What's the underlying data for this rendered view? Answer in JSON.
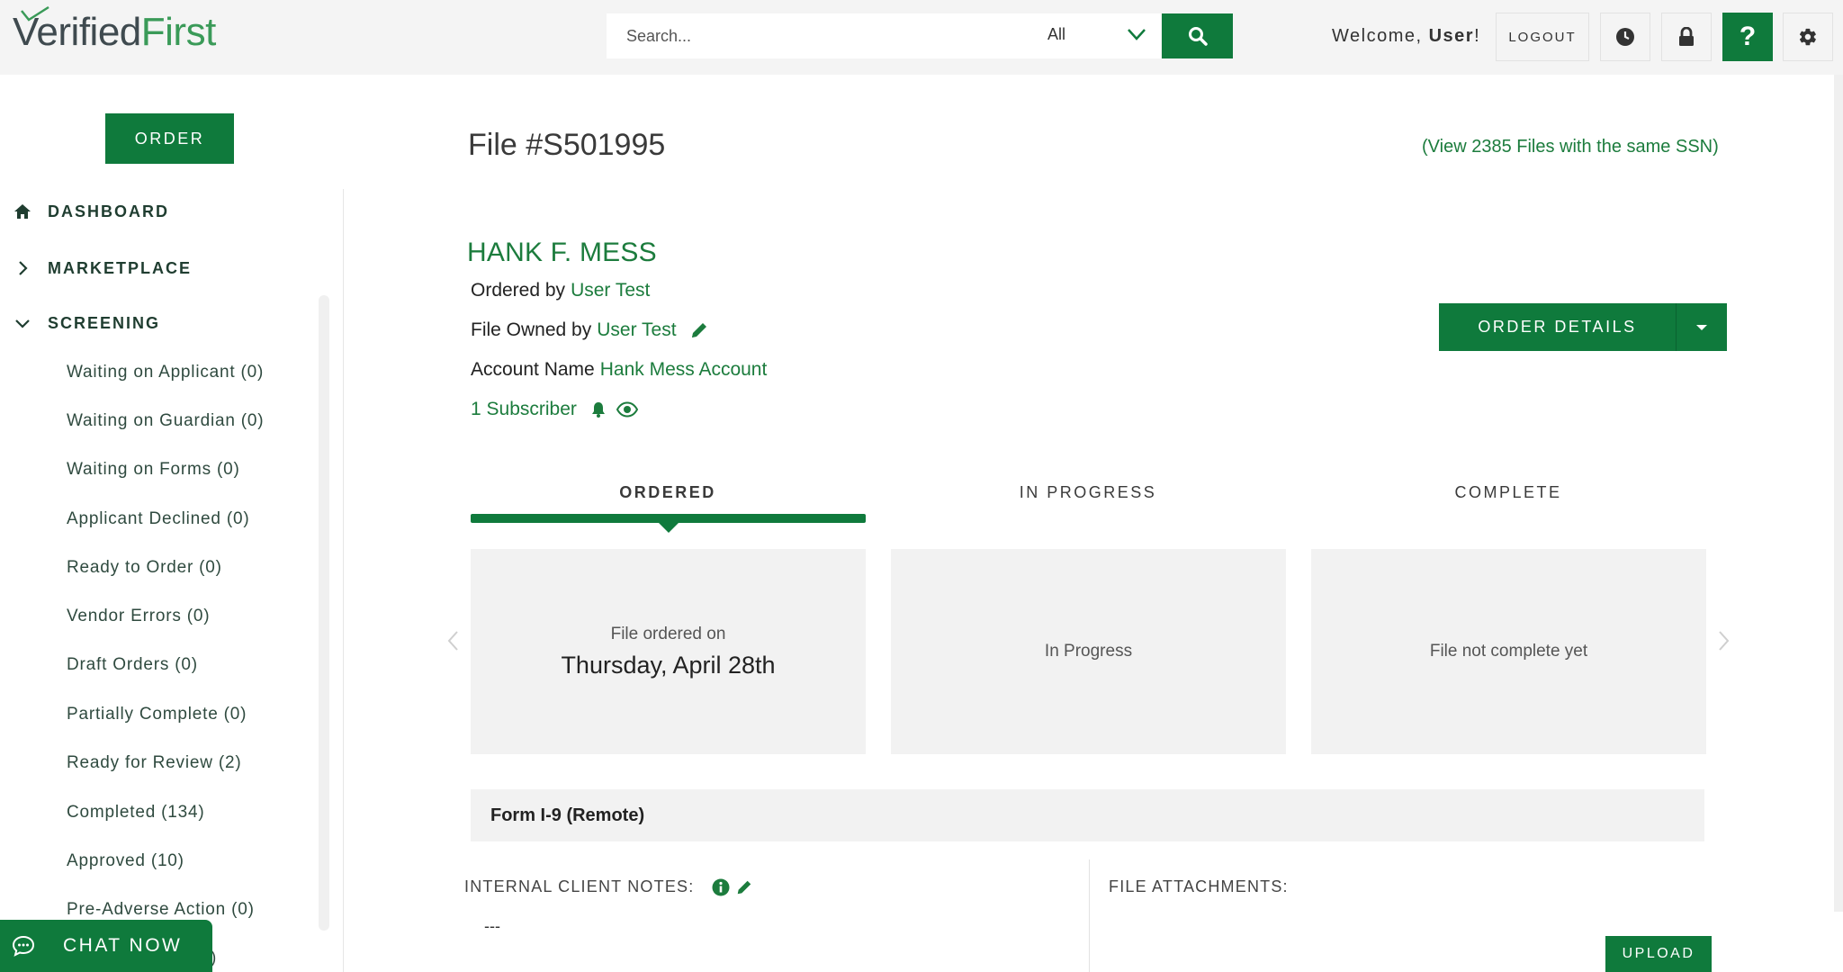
{
  "header": {
    "logo_part1": "Verified",
    "logo_part2": "First",
    "search_placeholder": "Search...",
    "search_scope": "All",
    "welcome_prefix": "Welcome, ",
    "welcome_user": "User",
    "welcome_suffix": "!",
    "logout_label": "LOGOUT",
    "icons": [
      "history-icon",
      "lock-icon",
      "help-icon",
      "gear-icon"
    ]
  },
  "sidebar": {
    "order_label": "ORDER",
    "nav": [
      {
        "label": "DASHBOARD",
        "icon": "home-icon"
      },
      {
        "label": "MARKETPLACE",
        "icon": "chevron-right-icon"
      },
      {
        "label": "SCREENING",
        "icon": "chevron-down-icon"
      }
    ],
    "screening_items": [
      "Waiting on Applicant (0)",
      "Waiting on Guardian (0)",
      "Waiting on Forms (0)",
      "Applicant Declined (0)",
      "Ready to Order (0)",
      "Vendor Errors (0)",
      "Draft Orders (0)",
      "Partially Complete (0)",
      "Ready for Review (2)",
      "Completed (134)",
      "Approved (10)",
      "Pre-Adverse Action (0)"
    ],
    "partial_item_tail": ")",
    "chat_label": "CHAT NOW"
  },
  "file": {
    "title": "File #S501995",
    "same_ssn_link": "(View 2385 Files with the same SSN)",
    "person_name": "HANK F. MESS",
    "ordered_by_label": "Ordered by",
    "ordered_by_value": "User Test",
    "owned_by_label": "File Owned by",
    "owned_by_value": "User Test",
    "account_label": "Account Name",
    "account_value": "Hank Mess Account",
    "subscribers": "1 Subscriber",
    "order_details_label": "ORDER DETAILS"
  },
  "progress": {
    "steps": [
      {
        "label": "ORDERED",
        "active": true
      },
      {
        "label": "IN PROGRESS",
        "active": false
      },
      {
        "label": "COMPLETE",
        "active": false
      }
    ],
    "cards": [
      {
        "small": "File ordered on",
        "big": "Thursday, April 28th"
      },
      {
        "small": "In Progress",
        "big": ""
      },
      {
        "small": "File not complete yet",
        "big": ""
      }
    ]
  },
  "form": {
    "title": "Form I-9 (Remote)",
    "notes_label": "INTERNAL CLIENT NOTES:",
    "notes_value": "---",
    "attachments_label": "FILE ATTACHMENTS:",
    "upload_label": "UPLOAD"
  },
  "colors": {
    "brand_green": "#0f7a3c",
    "link_green": "#1c7c3d",
    "logo_gray": "#3f4a4f",
    "logo_green": "#3a9a58",
    "header_bg": "#f4f4f4",
    "card_bg": "#f2f2f2"
  }
}
